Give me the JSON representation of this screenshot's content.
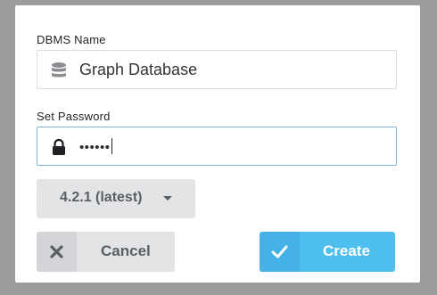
{
  "dialog": {
    "dbms_name_label": "DBMS Name",
    "dbms_name_value": "Graph Database",
    "password_label": "Set Password",
    "password_value": "••••••",
    "version_label": "4.2.1 (latest)",
    "cancel_label": "Cancel",
    "create_label": "Create"
  },
  "icons": {
    "name_field": "database-icon",
    "password_field": "lock-icon",
    "version": "chevron-down-icon",
    "cancel": "close-icon",
    "create": "check-icon"
  },
  "colors": {
    "primary": "#4fbff0",
    "focus_border": "#7fb6d9",
    "secondary_bg": "#e3e4e6",
    "overlay": "#9b9c9e"
  }
}
